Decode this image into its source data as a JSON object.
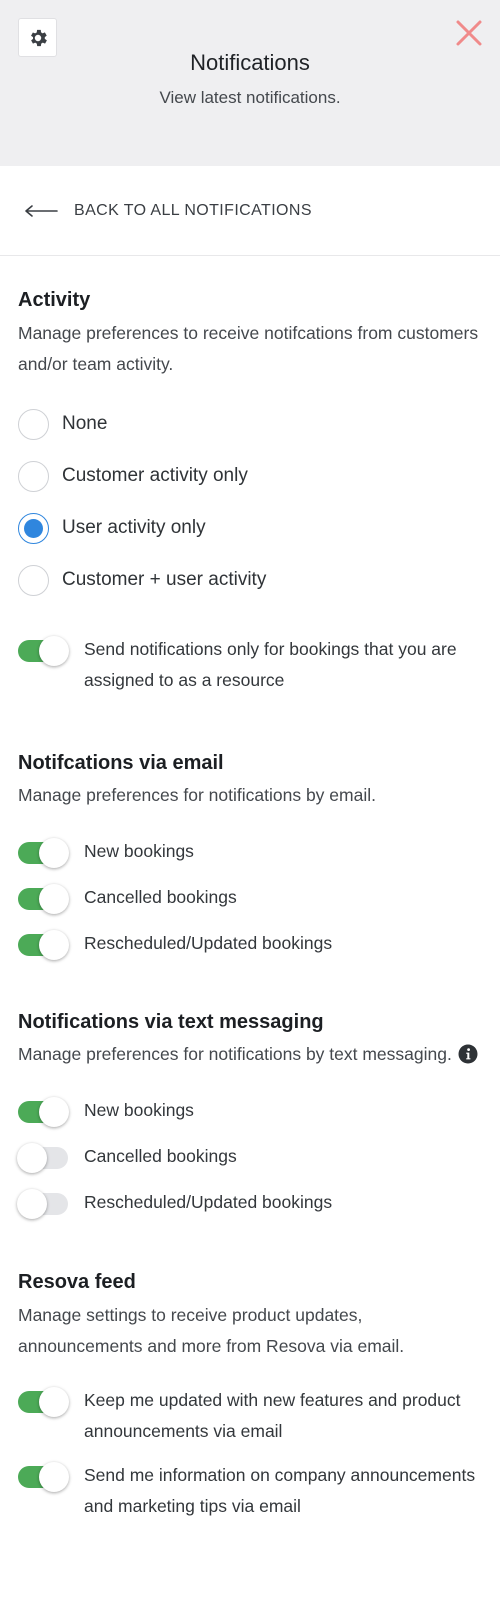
{
  "header": {
    "title": "Notifications",
    "subtitle": "View latest notifications.",
    "settings_icon": "gear-icon",
    "close_icon": "close-icon",
    "close_color": "#f08a8a"
  },
  "back": {
    "label": "BACK TO ALL NOTIFICATIONS",
    "icon": "arrow-left-icon"
  },
  "activity": {
    "title": "Activity",
    "description": "Manage preferences to receive notifcations from customers and/or team activity.",
    "options": [
      {
        "label": "None",
        "checked": false
      },
      {
        "label": "Customer activity only",
        "checked": false
      },
      {
        "label": "User activity only",
        "checked": true
      },
      {
        "label": "Customer + user activity",
        "checked": false
      }
    ],
    "assigned_toggle": {
      "label": "Send notifications only for bookings that you are assigned to as a resource",
      "on": true
    }
  },
  "email": {
    "title": "Notifcations via email",
    "description": "Manage preferences for notifications by email.",
    "toggles": [
      {
        "label": "New bookings",
        "on": true
      },
      {
        "label": "Cancelled bookings",
        "on": true
      },
      {
        "label": "Rescheduled/Updated bookings",
        "on": true
      }
    ]
  },
  "sms": {
    "title": "Notifications via text messaging",
    "description": "Manage preferences for notifications by text messaging.",
    "info_icon": "info-icon",
    "toggles": [
      {
        "label": "New bookings",
        "on": true
      },
      {
        "label": "Cancelled bookings",
        "on": false
      },
      {
        "label": "Rescheduled/Updated bookings",
        "on": false
      }
    ]
  },
  "feed": {
    "title": "Resova feed",
    "description": "Manage settings to receive product updates, announcements and more from Resova via email.",
    "toggles": [
      {
        "label": "Keep me updated with new features and product announcements via email",
        "on": true
      },
      {
        "label": "Send me information on company announcements and marketing tips via email",
        "on": true
      }
    ]
  },
  "colors": {
    "accent_blue": "#2f86de",
    "toggle_on": "#4caa57",
    "toggle_off": "#e4e5e8"
  }
}
